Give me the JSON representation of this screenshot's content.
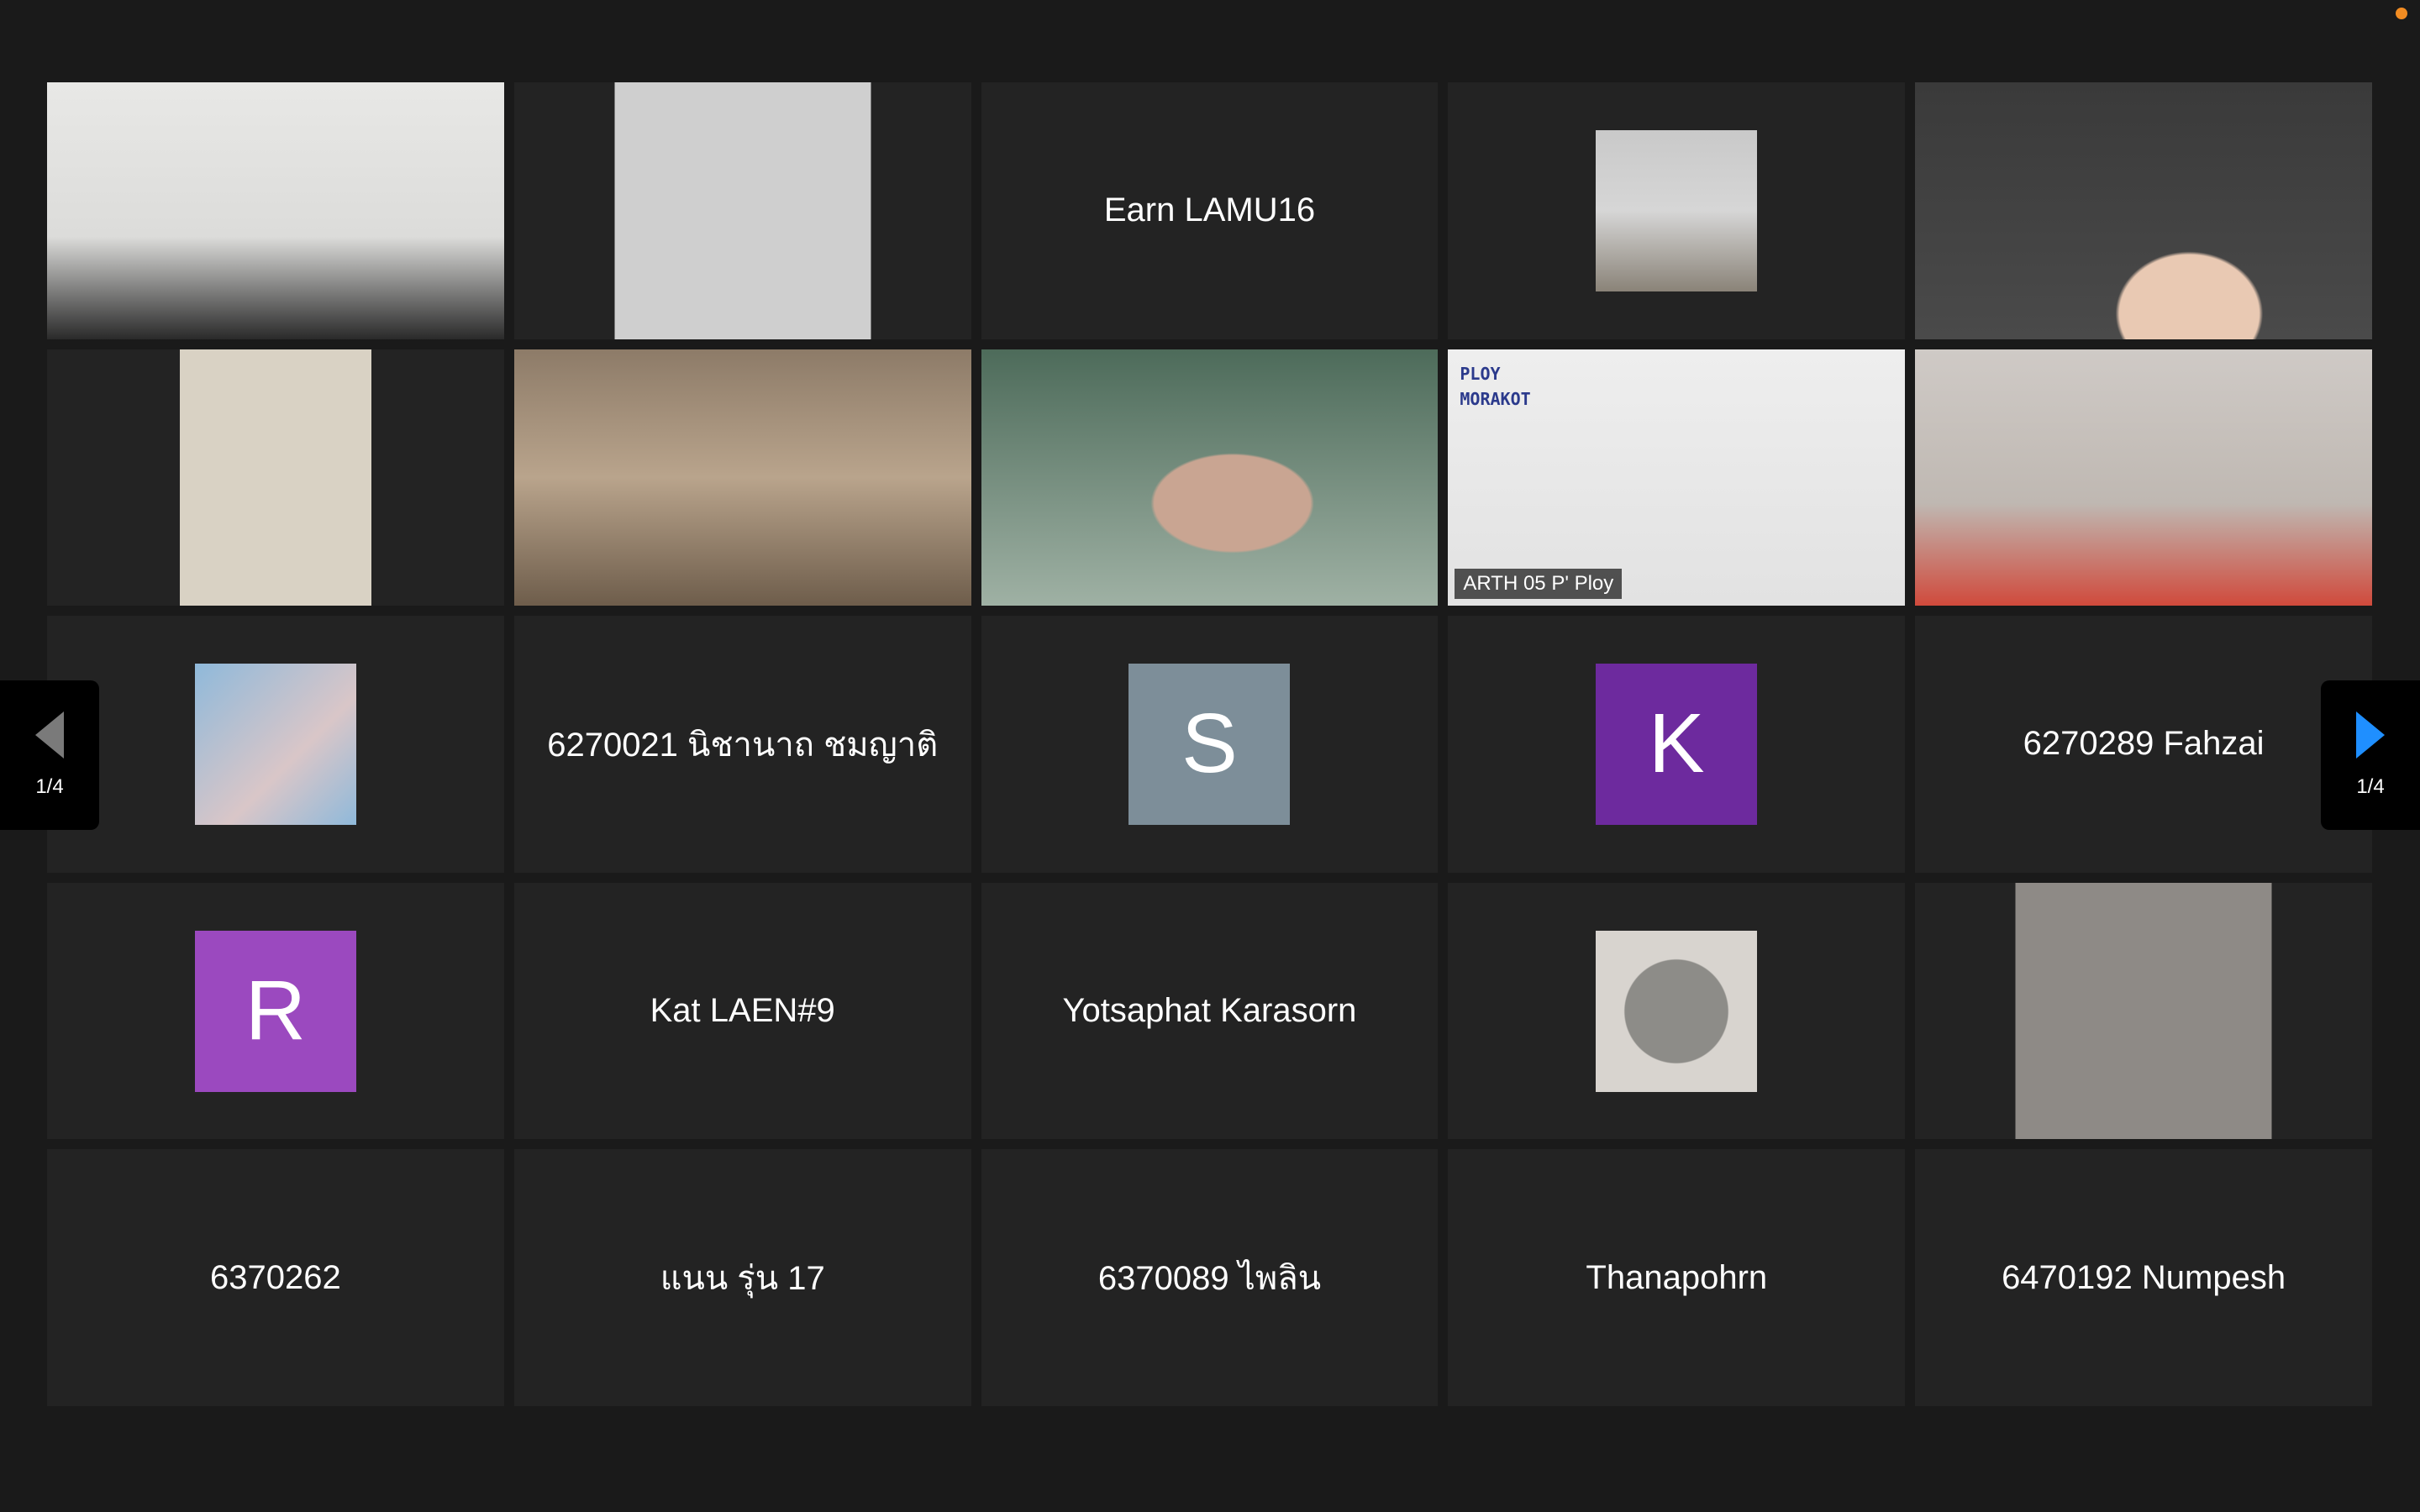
{
  "window": {
    "recording_indicator_color": "#f28c22"
  },
  "gallery": {
    "page_indicator": "1/4",
    "active_speaker_border": "#d6d97a",
    "tiles": [
      {
        "type": "video",
        "name": ""
      },
      {
        "type": "video",
        "name": ""
      },
      {
        "type": "name",
        "name": "Earn LAMU16"
      },
      {
        "type": "photo",
        "name": ""
      },
      {
        "type": "video",
        "name": ""
      },
      {
        "type": "video",
        "name": ""
      },
      {
        "type": "video",
        "name": ""
      },
      {
        "type": "video",
        "name": ""
      },
      {
        "type": "video",
        "name": "ARTH 05 P' Ploy",
        "caption_line1": "PLOY",
        "caption_line2": "MORAKOT",
        "active": true
      },
      {
        "type": "video",
        "name": ""
      },
      {
        "type": "photo",
        "name": ""
      },
      {
        "type": "name",
        "name": "6270021 นิชานาถ ชมญาติ"
      },
      {
        "type": "avatar",
        "letter": "S",
        "color": "#7d8e99"
      },
      {
        "type": "avatar",
        "letter": "K",
        "color": "#6d2a9e"
      },
      {
        "type": "name",
        "name": "6270289 Fahzai"
      },
      {
        "type": "avatar",
        "letter": "R",
        "color": "#9b49bf"
      },
      {
        "type": "name",
        "name": "Kat LAEN#9"
      },
      {
        "type": "name",
        "name": "Yotsaphat Karasorn"
      },
      {
        "type": "photo",
        "name": ""
      },
      {
        "type": "video",
        "name": ""
      },
      {
        "type": "name",
        "name": "6370262"
      },
      {
        "type": "name",
        "name": "แนน รุ่น 17"
      },
      {
        "type": "name",
        "name": "6370089 ไพลิน"
      },
      {
        "type": "name",
        "name": "Thanapohrn"
      },
      {
        "type": "name",
        "name": "6470192 Numpesh"
      }
    ]
  }
}
